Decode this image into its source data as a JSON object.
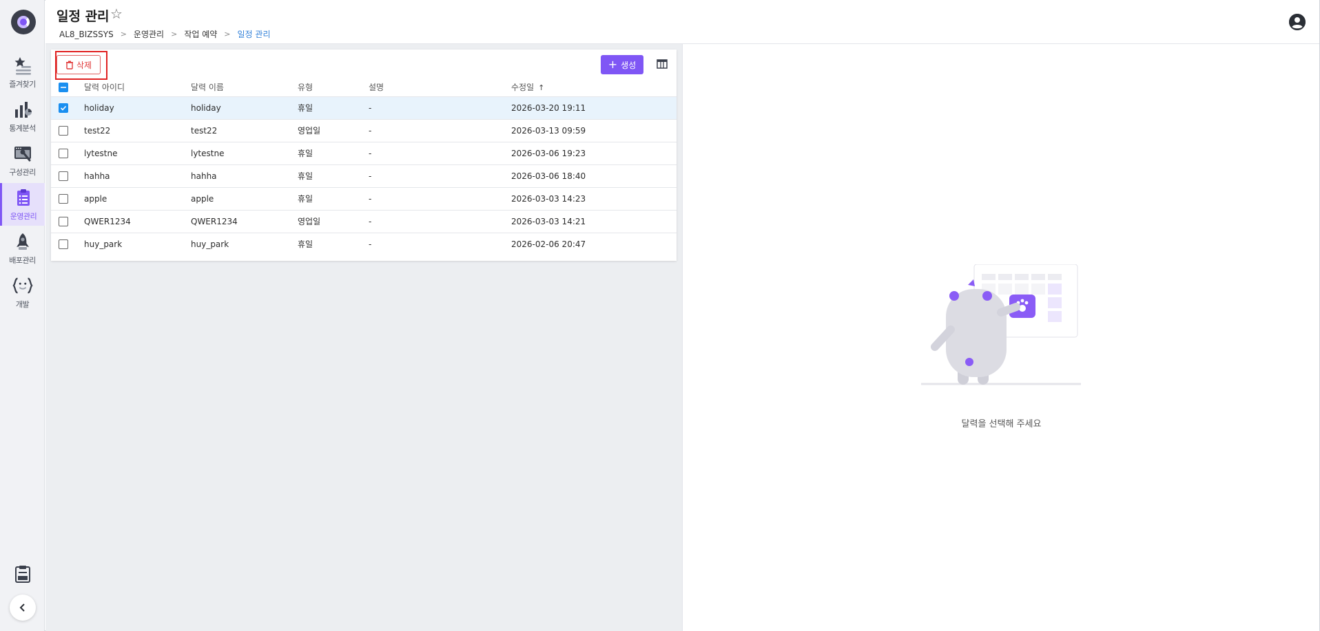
{
  "header": {
    "title": "일정 관리",
    "breadcrumb": [
      "AL8_BIZSSYS",
      "운영관리",
      "작업 예약",
      "일정 관리"
    ]
  },
  "sidebar": {
    "items": [
      {
        "label": "즐겨찾기",
        "icon": "star-list-icon",
        "active": false
      },
      {
        "label": "통계분석",
        "icon": "chart-icon",
        "active": false
      },
      {
        "label": "구성관리",
        "icon": "settings-wrench-icon",
        "active": false
      },
      {
        "label": "운영관리",
        "icon": "clipboard-list-icon",
        "active": true
      },
      {
        "label": "배포관리",
        "icon": "rocket-icon",
        "active": false
      },
      {
        "label": "개발",
        "icon": "code-braces-icon",
        "active": false
      }
    ],
    "bottom": {
      "log_icon": "log-icon",
      "collapse_icon": "chevron-left-icon"
    }
  },
  "toolbar": {
    "delete_label": "삭제",
    "create_label": "생성",
    "column_settings_icon": "table-columns-icon"
  },
  "table": {
    "columns": [
      "달력 아이디",
      "달력 이름",
      "유형",
      "설명",
      "수정일"
    ],
    "sorted_column": "수정일",
    "sort_direction": "asc",
    "rows": [
      {
        "id": "holiday",
        "name": "holiday",
        "type": "휴일",
        "desc": "-",
        "modified": "2026-03-20 19:11",
        "checked": true
      },
      {
        "id": "test22",
        "name": "test22",
        "type": "영업일",
        "desc": "-",
        "modified": "2026-03-13 09:59",
        "checked": false
      },
      {
        "id": "lytestne",
        "name": "lytestne",
        "type": "휴일",
        "desc": "-",
        "modified": "2026-03-06 19:23",
        "checked": false
      },
      {
        "id": "hahha",
        "name": "hahha",
        "type": "휴일",
        "desc": "-",
        "modified": "2026-03-06 18:40",
        "checked": false
      },
      {
        "id": "apple",
        "name": "apple",
        "type": "휴일",
        "desc": "-",
        "modified": "2026-03-03 14:23",
        "checked": false
      },
      {
        "id": "QWER1234",
        "name": "QWER1234",
        "type": "영업일",
        "desc": "-",
        "modified": "2026-03-03 14:21",
        "checked": false
      },
      {
        "id": "huy_park",
        "name": "huy_park",
        "type": "휴일",
        "desc": "-",
        "modified": "2026-02-06 20:47",
        "checked": false
      }
    ]
  },
  "detail": {
    "empty_message": "달력을 선택해 주세요"
  },
  "colors": {
    "accent": "#7f56f5",
    "danger": "#e03a3a",
    "selected_row": "#e8f3fc",
    "checkbox": "#1a8ff0",
    "link": "#2f7fd8"
  }
}
